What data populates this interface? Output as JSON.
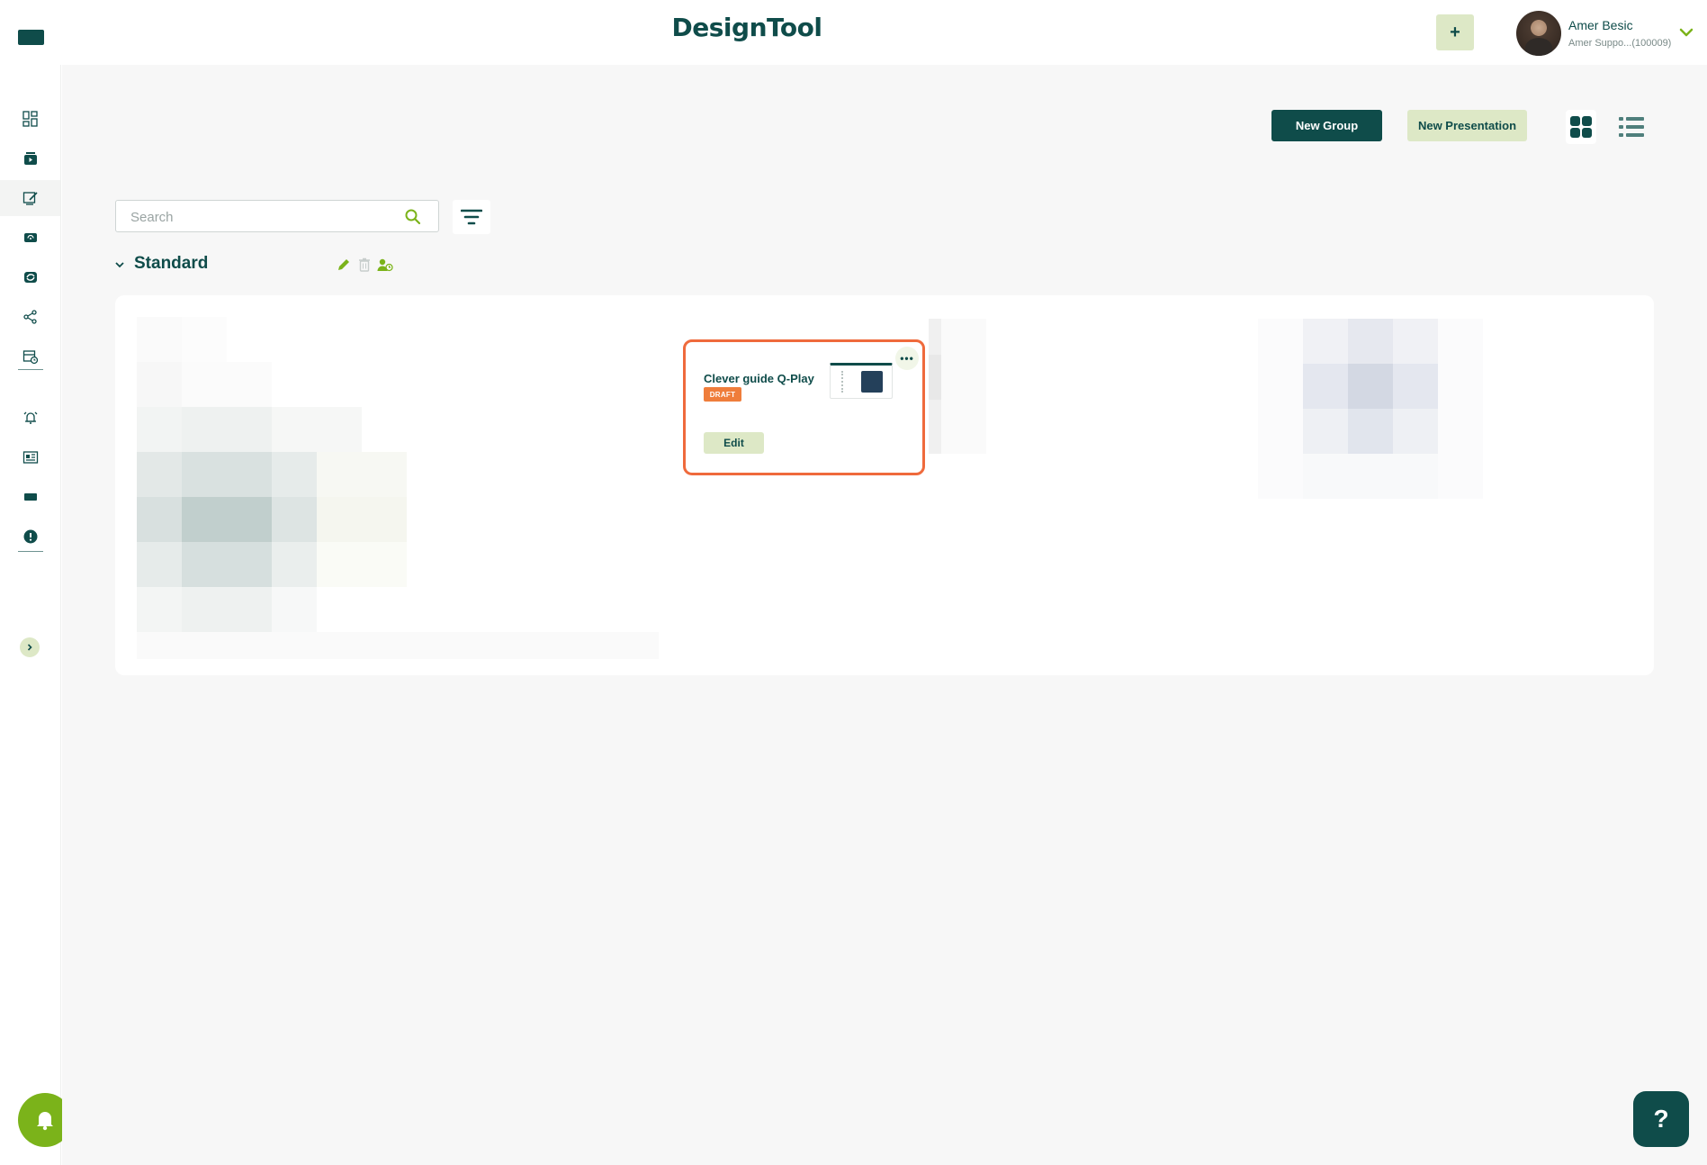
{
  "header": {
    "brand": "DesignTool",
    "add_label": "+",
    "user": {
      "name": "Amer Besic",
      "subtitle": "Amer Suppo...(100009)"
    }
  },
  "sidebar": {
    "items": [
      {
        "icon": "dashboard-icon"
      },
      {
        "icon": "media-icon"
      },
      {
        "icon": "presentation-edit-icon",
        "active": true
      },
      {
        "icon": "player-icon"
      },
      {
        "icon": "playlist-icon"
      },
      {
        "icon": "share-icon"
      },
      {
        "icon": "schedule-icon"
      },
      {
        "icon": "alarm-icon"
      },
      {
        "icon": "news-icon"
      },
      {
        "icon": "screen-icon"
      },
      {
        "icon": "alert-icon"
      }
    ]
  },
  "toolbar": {
    "new_group_label": "New Group",
    "new_presentation_label": "New Presentation"
  },
  "search": {
    "placeholder": "Search",
    "value": ""
  },
  "group": {
    "title": "Standard",
    "presentations": [
      {
        "title": "Clever guide Q-Play",
        "status": "DRAFT",
        "edit_label": "Edit",
        "menu_label": "•••"
      }
    ]
  },
  "help": {
    "label": "?"
  },
  "colors": {
    "primary": "#0f4c4a",
    "accent_light": "#dde8c6",
    "accent_green": "#7bb31a",
    "highlight": "#ef6a3c",
    "draft": "#ef7d3b"
  }
}
